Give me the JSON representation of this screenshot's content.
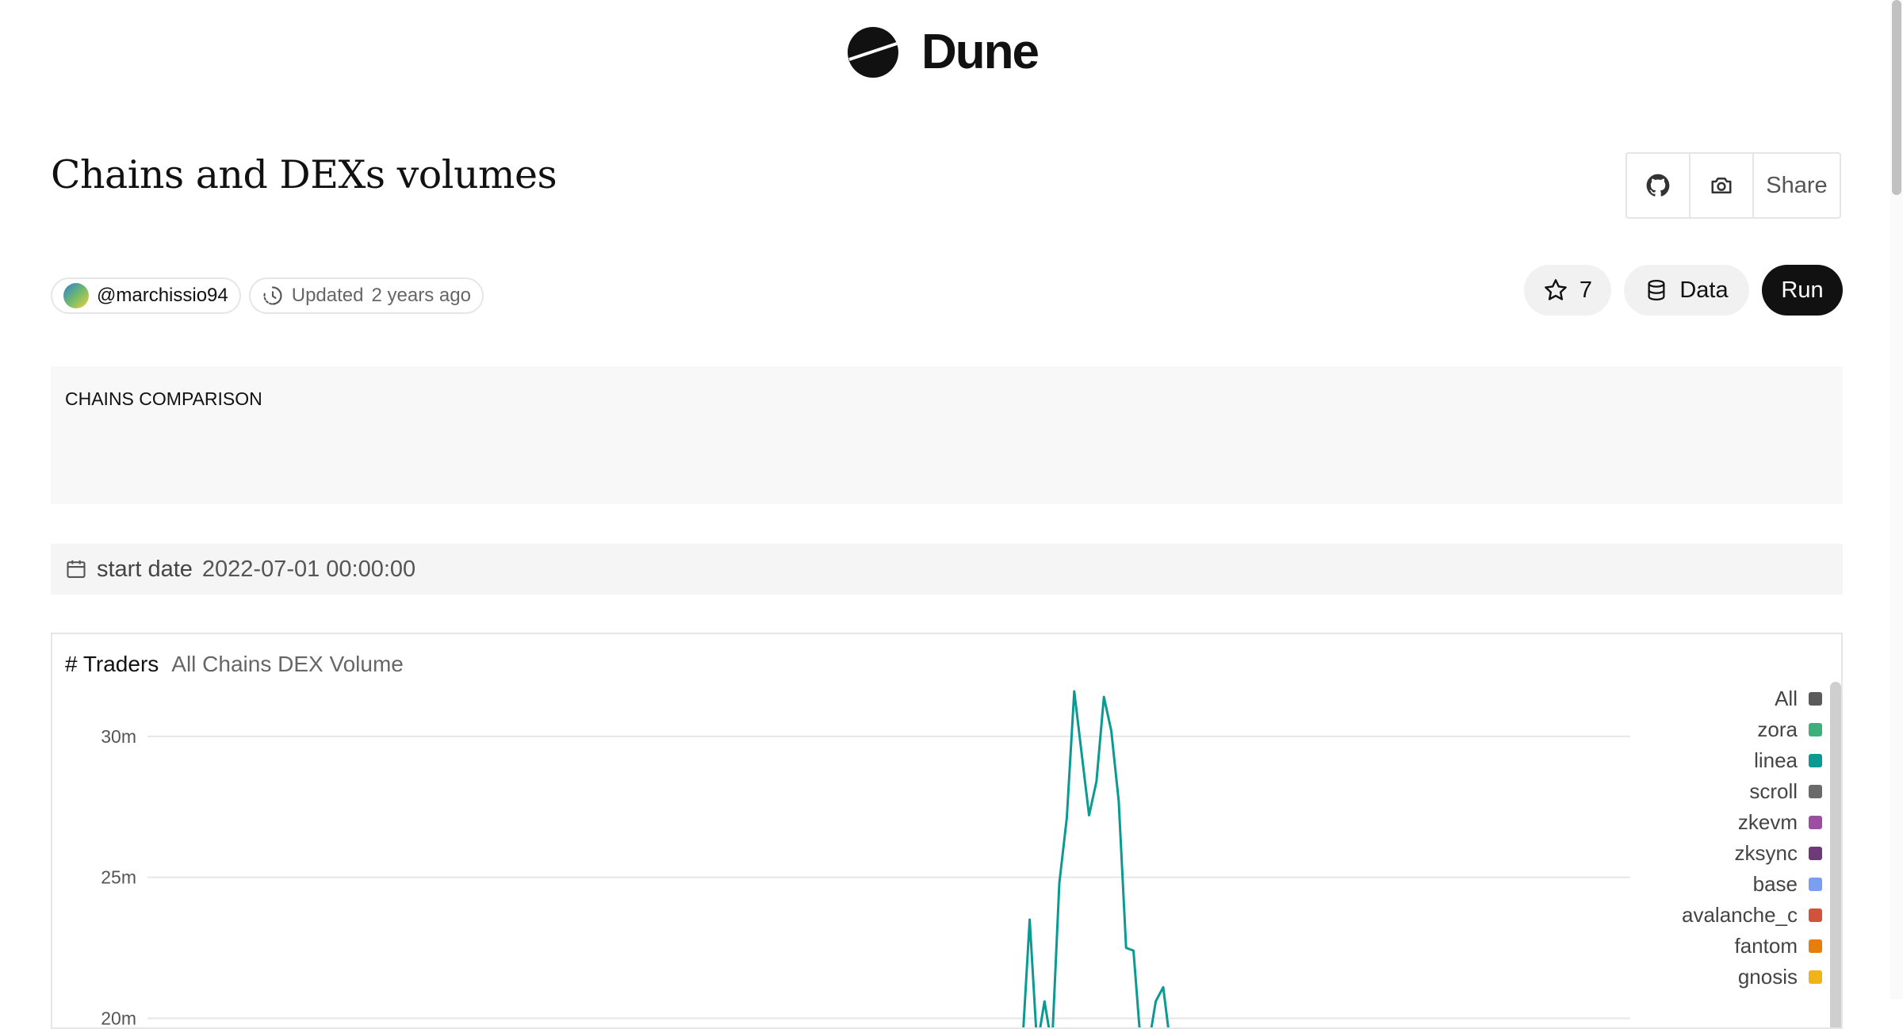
{
  "brand": {
    "name": "Dune"
  },
  "dashboard": {
    "title": "Chains and DEXs volumes",
    "author": "@marchissio94",
    "updated_label": "Updated",
    "updated_value": "2 years ago"
  },
  "actions": {
    "share_label": "Share",
    "star_count": "7",
    "data_label": "Data",
    "run_label": "Run"
  },
  "text_widget": {
    "content": "CHAINS COMPARISON"
  },
  "parameter": {
    "label": "start date",
    "value": "2022-07-01 00:00:00"
  },
  "chart_tabs": [
    {
      "label": "# Traders",
      "active": true
    },
    {
      "label": "All Chains DEX Volume",
      "active": false
    }
  ],
  "legend": [
    {
      "name": "All",
      "color": "#5a5a5a"
    },
    {
      "name": "zora",
      "color": "#3bb07a"
    },
    {
      "name": "linea",
      "color": "#0a9a92"
    },
    {
      "name": "scroll",
      "color": "#6a6a6a"
    },
    {
      "name": "zkevm",
      "color": "#9c4fa0"
    },
    {
      "name": "zksync",
      "color": "#6e3a78"
    },
    {
      "name": "base",
      "color": "#7a9ef0"
    },
    {
      "name": "avalanche_c",
      "color": "#d4513b"
    },
    {
      "name": "fantom",
      "color": "#e67e0e"
    },
    {
      "name": "gnosis",
      "color": "#f0b419"
    }
  ],
  "chart_data": {
    "type": "line",
    "yticks": [
      "30m",
      "25m",
      "20m"
    ],
    "ytick_values": [
      30,
      25,
      20
    ],
    "ylim": [
      19,
      32.5
    ],
    "xlim": [
      0,
      100
    ],
    "series": [
      {
        "name": "linea",
        "color": "#0a9a92",
        "x": [
          59.0,
          59.5,
          60.0,
          60.5,
          61.0,
          61.5,
          62.0,
          62.5,
          63.0,
          63.5,
          64.0,
          64.5,
          65.0,
          65.5,
          66.0,
          66.5,
          67.0,
          67.5,
          68.0,
          68.5,
          69.0
        ],
        "y": [
          19.0,
          23.5,
          19.0,
          20.6,
          19.0,
          24.8,
          27.1,
          31.6,
          29.4,
          27.2,
          28.4,
          31.4,
          30.2,
          27.7,
          22.5,
          22.4,
          19.0,
          19.0,
          20.6,
          21.1,
          19.0
        ]
      }
    ]
  }
}
